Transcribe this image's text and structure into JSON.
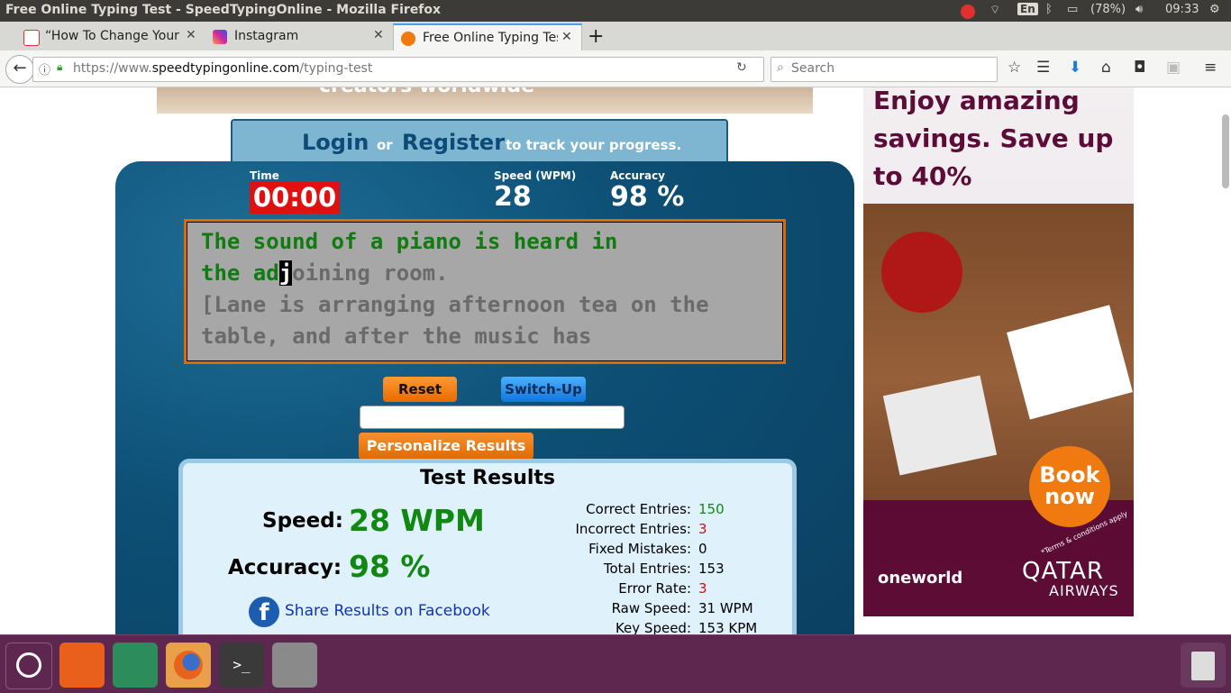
{
  "system": {
    "window_title": "Free Online Typing Test - SpeedTypingOnline - Mozilla Firefox",
    "keyboard": "En",
    "battery": "(78%)",
    "clock": "09:33"
  },
  "tabs": [
    {
      "label": "“How To Change Your"
    },
    {
      "label": "Instagram"
    },
    {
      "label": "Free Online Typing Tes"
    }
  ],
  "nav": {
    "url_prefix": "https://www.",
    "url_domain": "speedtypingonline.com",
    "url_path": "/typing-test",
    "search_placeholder": "Search"
  },
  "banner_text": "creators worldwide",
  "login": {
    "login_label": "Login",
    "or_label": "or",
    "register_label": "Register",
    "suffix": "to track your progress."
  },
  "stats": {
    "time_label": "Time",
    "time_value": "00:00",
    "speed_label": "Speed (WPM)",
    "speed_value": "28",
    "accuracy_label": "Accuracy",
    "accuracy_value": "98 %"
  },
  "passage": {
    "line1_typed": "The sound of a piano is heard in",
    "line2_typed": "the ad",
    "line2_cursor": "j",
    "line2_pending": "oining room.",
    "line3": "[Lane is arranging afternoon tea on the",
    "line4": "table, and after the music has"
  },
  "buttons": {
    "reset": "Reset",
    "switch_up": "Switch-Up",
    "personalize": "Personalize Results"
  },
  "results": {
    "title": "Test Results",
    "speed_label": "Speed:",
    "speed_value": "28 WPM",
    "accuracy_label": "Accuracy:",
    "accuracy_value": "98 %",
    "share_label": "Share Results on Facebook",
    "details": [
      {
        "label": "Correct Entries:",
        "value": "150",
        "color": "#118811"
      },
      {
        "label": "Incorrect Entries:",
        "value": "3",
        "color": "#d01010"
      },
      {
        "label": "Fixed Mistakes:",
        "value": "0",
        "color": "#000000"
      },
      {
        "label": "Total Entries:",
        "value": "153",
        "color": "#000000"
      },
      {
        "label": "Error Rate:",
        "value": "3",
        "color": "#d01010"
      },
      {
        "label": "Raw Speed:",
        "value": "31 WPM",
        "color": "#000000"
      },
      {
        "label": "Key Speed:",
        "value": "153 KPM",
        "color": "#000000"
      }
    ]
  },
  "ad": {
    "headline": "Enjoy amazing savings. Save up to 40%",
    "cta": "Book now",
    "terms": "*Terms & conditions apply",
    "alliance": "oneworld",
    "brand_top": "QATAR",
    "brand_bottom": "AIRWAYS"
  },
  "colors": {
    "accent_orange": "#f07a10",
    "switch_blue": "#1b8fe8",
    "time_red": "#e01010",
    "launcher": "#5e2750"
  }
}
